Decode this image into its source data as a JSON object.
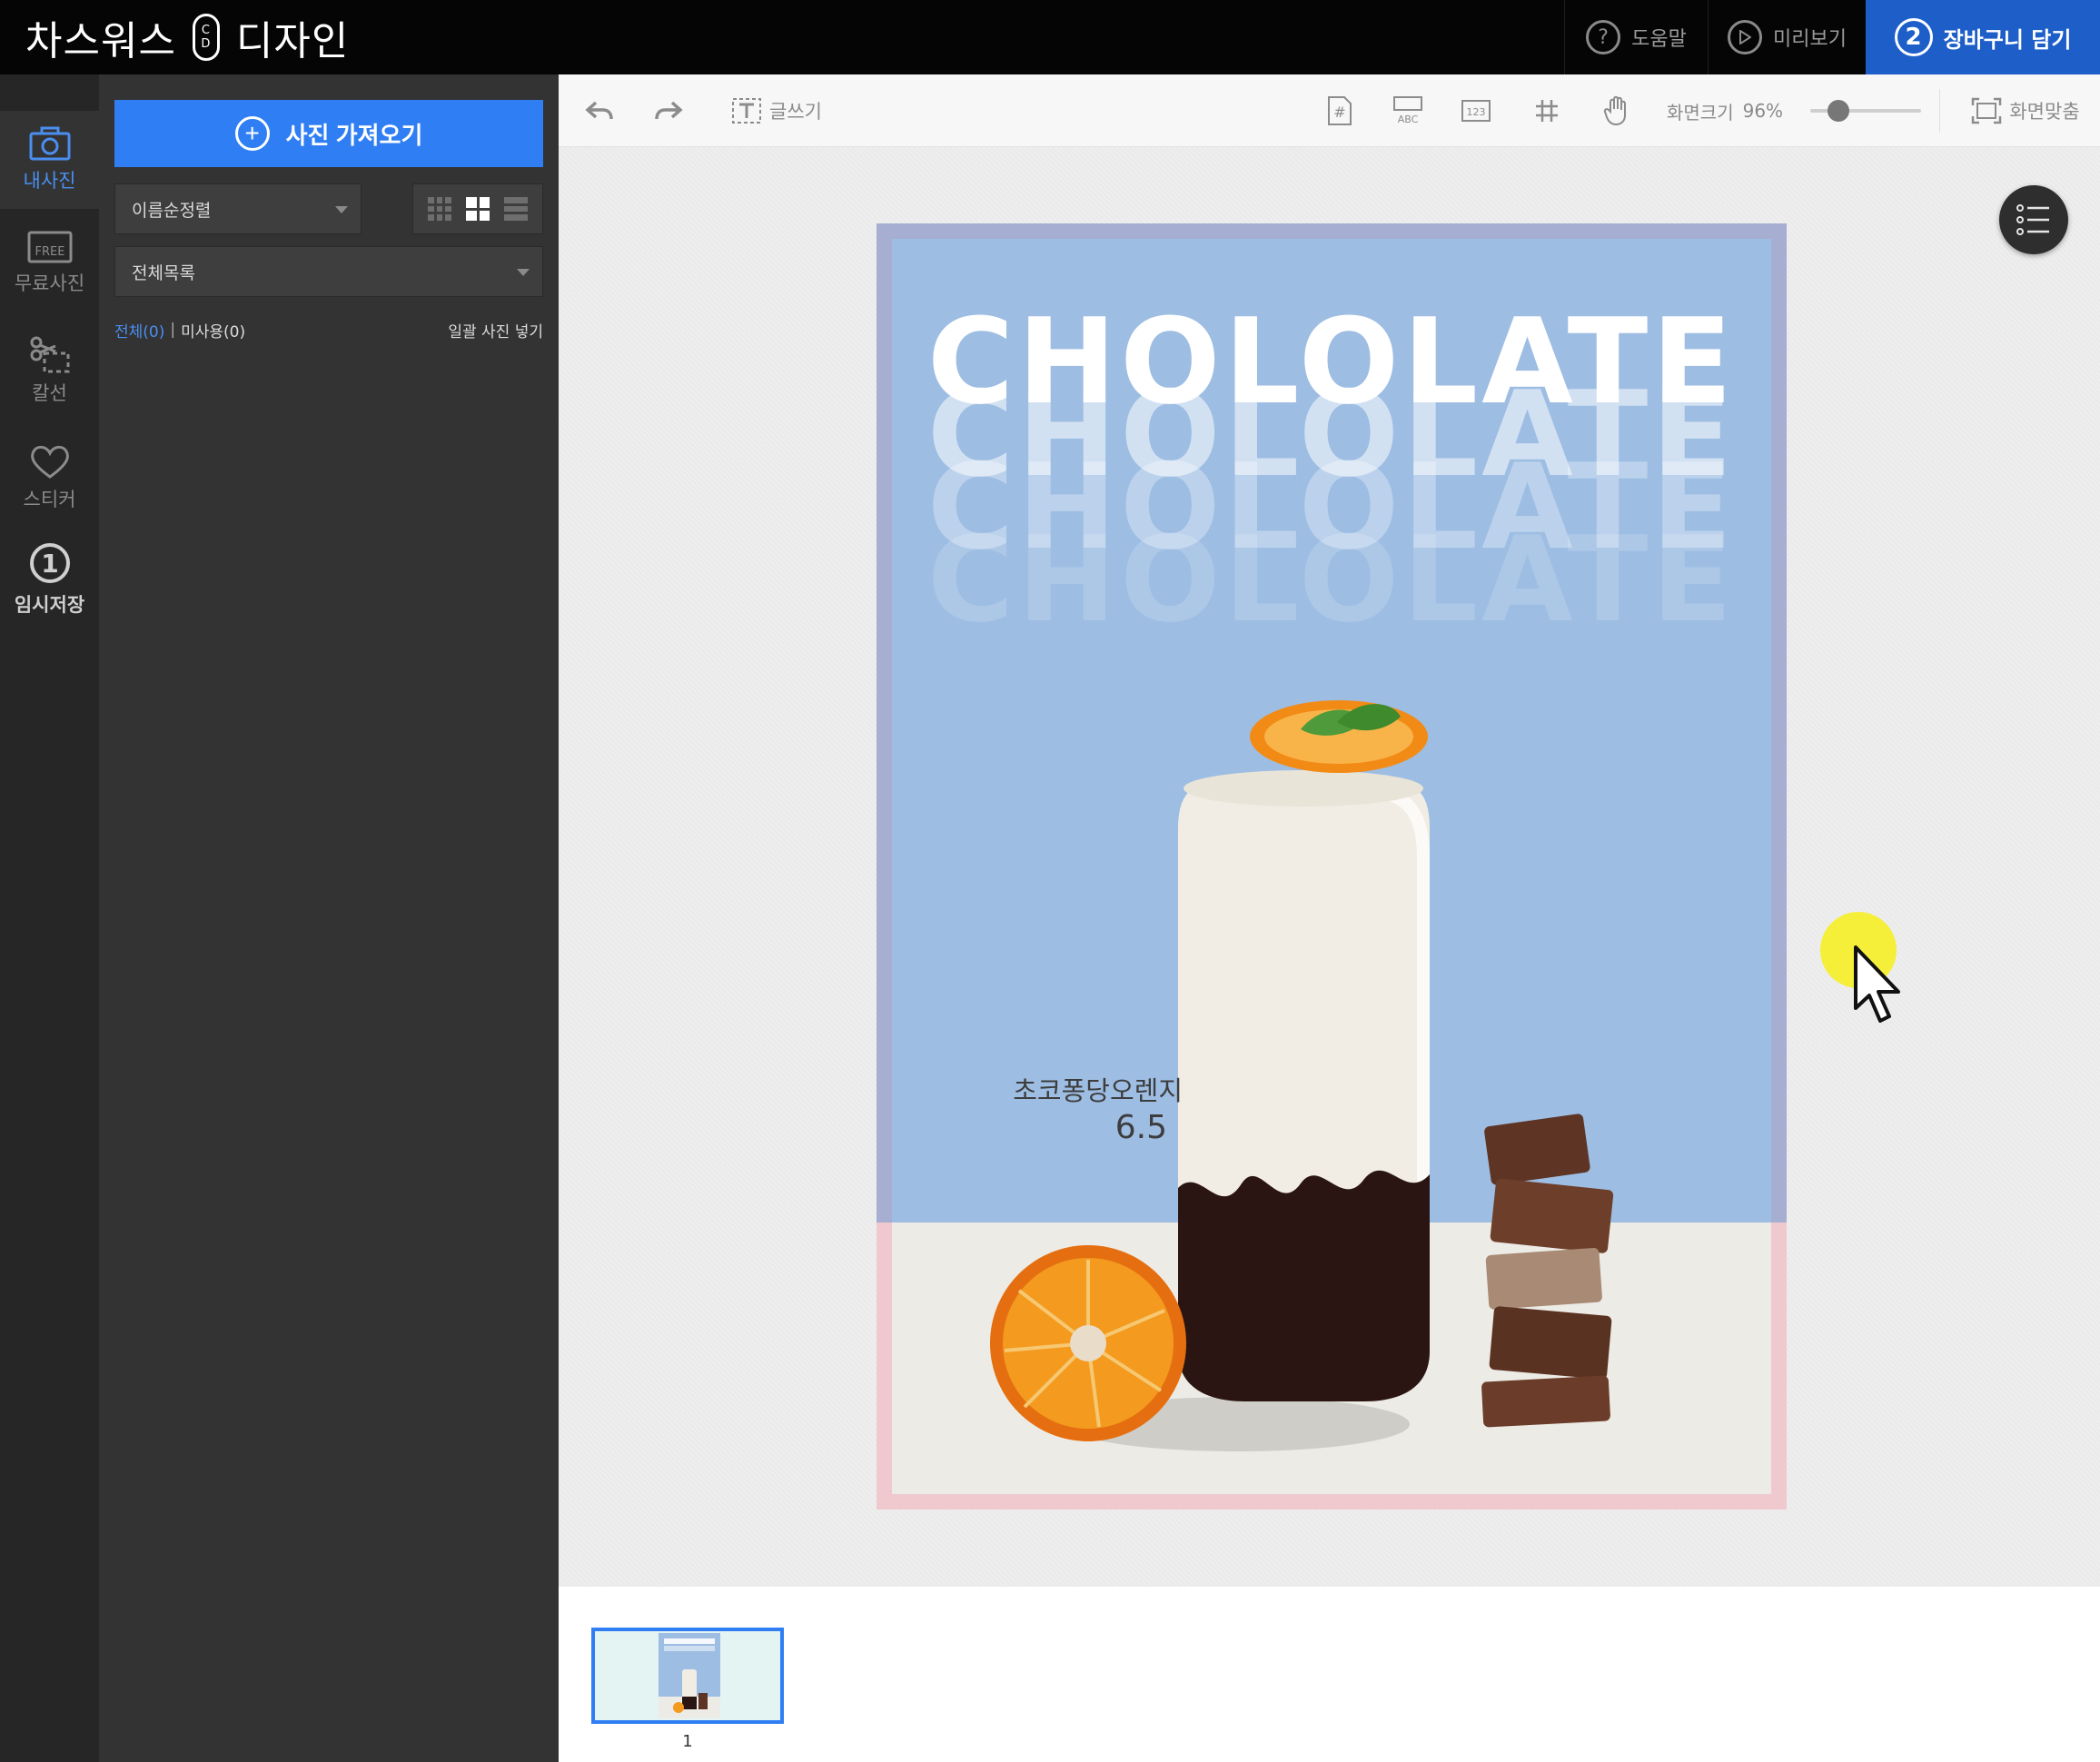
{
  "app": {
    "brand_left": "차스워스",
    "brand_badge_top": "C",
    "brand_badge_bottom": "D",
    "brand_right": "디자인"
  },
  "topbar": {
    "help_label": "도움말",
    "help_icon": "?",
    "preview_label": "미리보기",
    "cart_step": "2",
    "cart_label": "장바구니 담기"
  },
  "rail": {
    "items": [
      {
        "label": "내사진",
        "icon": "photo-icon"
      },
      {
        "label": "무료사진",
        "icon": "free-photo-icon"
      },
      {
        "label": "칼선",
        "icon": "scissors-icon"
      },
      {
        "label": "스티커",
        "icon": "heart-icon"
      },
      {
        "label": "임시저장",
        "icon": "temp-save-icon",
        "badge": "1"
      }
    ],
    "free_badge": "FREE"
  },
  "panel": {
    "import_label": "사진 가져오기",
    "sort_value": "이름순정렬",
    "list_value": "전체목록",
    "filter_all": "전체(0)",
    "filter_sep": "|",
    "filter_unused": "미사용(0)",
    "bulk_insert": "일괄 사진 넣기"
  },
  "toolbar": {
    "text_label": "글쓰기",
    "abc_label": "ABC",
    "num_label": "123",
    "zoom_label": "화면크기",
    "zoom_value": "96%",
    "zoom_fraction": 0.25,
    "fit_label": "화면맞춤"
  },
  "poster": {
    "headline": "CHOLOLATE",
    "drink_name": "초코퐁당오렌지",
    "drink_price": "6.5",
    "colors": {
      "sky": "#9dbde3",
      "floor": "#ecebe5",
      "bleed_top": "#a6aed2",
      "bleed_bottom": "#efc9ce"
    }
  },
  "pages": {
    "current_number": "1"
  },
  "colors": {
    "accent": "#2f7ef3",
    "cart": "#1d5ec9",
    "topbar": "#050505",
    "panel": "#333333",
    "rail": "#262626"
  }
}
